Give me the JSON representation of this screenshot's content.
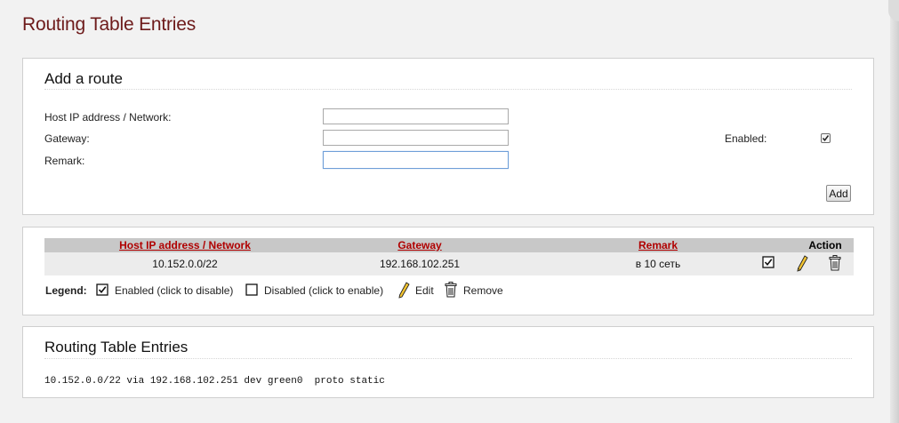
{
  "page": {
    "title": "Routing Table Entries"
  },
  "add_route": {
    "heading": "Add a route",
    "host_label": "Host IP address / Network:",
    "host_value": "",
    "gateway_label": "Gateway:",
    "gateway_value": "",
    "remark_label": "Remark:",
    "remark_value": "",
    "enabled_label": "Enabled:",
    "enabled_checked": true,
    "add_button": "Add"
  },
  "routes_table": {
    "columns": [
      "Host IP address / Network",
      "Gateway",
      "Remark",
      "Action"
    ],
    "rows": [
      {
        "host": "10.152.0.0/22",
        "gateway": "192.168.102.251",
        "remark": "в 10 сеть",
        "enabled": true
      }
    ],
    "legend": {
      "label": "Legend:",
      "enabled": "Enabled (click to disable)",
      "disabled": "Disabled (click to enable)",
      "edit": "Edit",
      "remove": "Remove"
    }
  },
  "routing_entries": {
    "heading": "Routing Table Entries",
    "lines": [
      "10.152.0.0/22 via 192.168.102.251 dev green0  proto static"
    ]
  },
  "colors": {
    "title": "#6d1a1a",
    "header_link": "#b00000",
    "table_header_bg": "#c8c8c8",
    "row_bg": "#ececec",
    "page_bg": "#f2f2f2"
  },
  "icons": {
    "enabled": "checkbox-checked-icon",
    "disabled": "checkbox-empty-icon",
    "edit": "pencil-icon",
    "remove": "trash-icon"
  }
}
